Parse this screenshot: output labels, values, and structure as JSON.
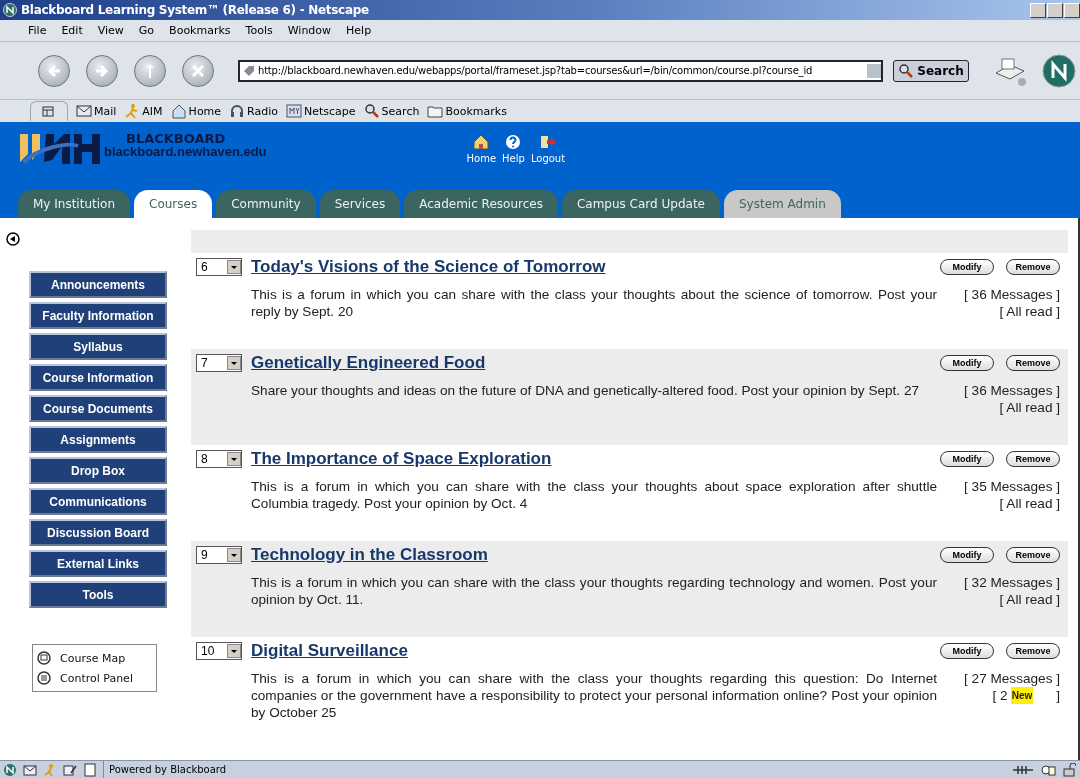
{
  "window": {
    "title": "Blackboard Learning System™ (Release 6) - Netscape"
  },
  "menu": [
    "File",
    "Edit",
    "View",
    "Go",
    "Bookmarks",
    "Tools",
    "Window",
    "Help"
  ],
  "address": {
    "value": "http://blackboard.newhaven.edu/webapps/portal/frameset.jsp?tab=courses&url=/bin/common/course.pl?course_id"
  },
  "search_button": "Search",
  "personal_toolbar": [
    {
      "kind": "mail",
      "label": "Mail"
    },
    {
      "kind": "aim",
      "label": "AIM"
    },
    {
      "kind": "home",
      "label": "Home"
    },
    {
      "kind": "radio",
      "label": "Radio"
    },
    {
      "kind": "my",
      "label": "Netscape"
    },
    {
      "kind": "search",
      "label": "Search"
    },
    {
      "kind": "bookmarks",
      "label": "Bookmarks"
    }
  ],
  "header": {
    "site_title": "BLACKBOARD",
    "site_url": "blackboard.newhaven.edu",
    "links": [
      {
        "kind": "home",
        "label": "Home"
      },
      {
        "kind": "help",
        "label": "Help"
      },
      {
        "kind": "logout",
        "label": "Logout"
      }
    ]
  },
  "tabs": [
    {
      "label": "My Institution",
      "selected": false,
      "kind": "normal"
    },
    {
      "label": "Courses",
      "selected": true,
      "kind": "normal"
    },
    {
      "label": "Community",
      "selected": false,
      "kind": "normal"
    },
    {
      "label": "Services",
      "selected": false,
      "kind": "normal"
    },
    {
      "label": "Academic Resources",
      "selected": false,
      "kind": "normal"
    },
    {
      "label": "Campus Card Update",
      "selected": false,
      "kind": "normal"
    },
    {
      "label": "System Admin",
      "selected": false,
      "kind": "admin"
    }
  ],
  "sidebar": {
    "buttons": [
      "Announcements",
      "Faculty Information",
      "Syllabus",
      "Course Information",
      "Course Documents",
      "Assignments",
      "Drop Box",
      "Communications",
      "Discussion Board",
      "External Links",
      "Tools"
    ],
    "tools": [
      "Course Map",
      "Control Panel"
    ]
  },
  "forums": [
    {
      "actions": [
        "Modify",
        "Remove"
      ],
      "order": "6",
      "title": "Today's Visions of the Science of Tomorrow",
      "description": "This is a forum in which you can share with the class your thoughts about the science of tomorrow. Post your reply by Sept. 20",
      "messages": "[ 36 Messages ]",
      "status": {
        "kind": "read",
        "text": "[ All read ]"
      }
    },
    {
      "actions": [
        "Modify",
        "Remove"
      ],
      "order": "7",
      "title": "Genetically Engineered Food",
      "description": "Share your thoughts and ideas on the future of DNA and genetically-altered food. Post your opinion by Sept. 27",
      "messages": "[ 36 Messages ]",
      "status": {
        "kind": "read",
        "text": "[ All read ]"
      }
    },
    {
      "actions": [
        "Modify",
        "Remove"
      ],
      "order": "8",
      "title": "The Importance of Space Exploration",
      "description": "This is a forum in which you can share with the class your thoughts about space exploration after shuttle Columbia tragedy. Post your opinion by Oct. 4",
      "messages": "[ 35 Messages ]",
      "status": {
        "kind": "read",
        "text": "[ All read ]"
      }
    },
    {
      "actions": [
        "Modify",
        "Remove"
      ],
      "order": "9",
      "title": "Technology in the Classroom",
      "description": "This is a forum in which you can share with the class your thoughts regarding technology and women. Post your opinion by Oct. 11.",
      "messages": "[ 32 Messages ]",
      "status": {
        "kind": "read",
        "text": "[ All read ]"
      }
    },
    {
      "actions": [
        "Modify",
        "Remove"
      ],
      "order": "10",
      "title": "Digital Surveillance",
      "description": "This is a forum in which you can share with the class your thoughts regarding this question: Do Internet companies or the government have a responsibility to protect your personal information online? Post your opinion by October 25",
      "messages": "[ 27 Messages ]",
      "status": {
        "kind": "new",
        "prefix": "[ 2",
        "badge": "New",
        "suffix": "]"
      }
    }
  ],
  "status_bar": {
    "text": "Powered by Blackboard"
  }
}
